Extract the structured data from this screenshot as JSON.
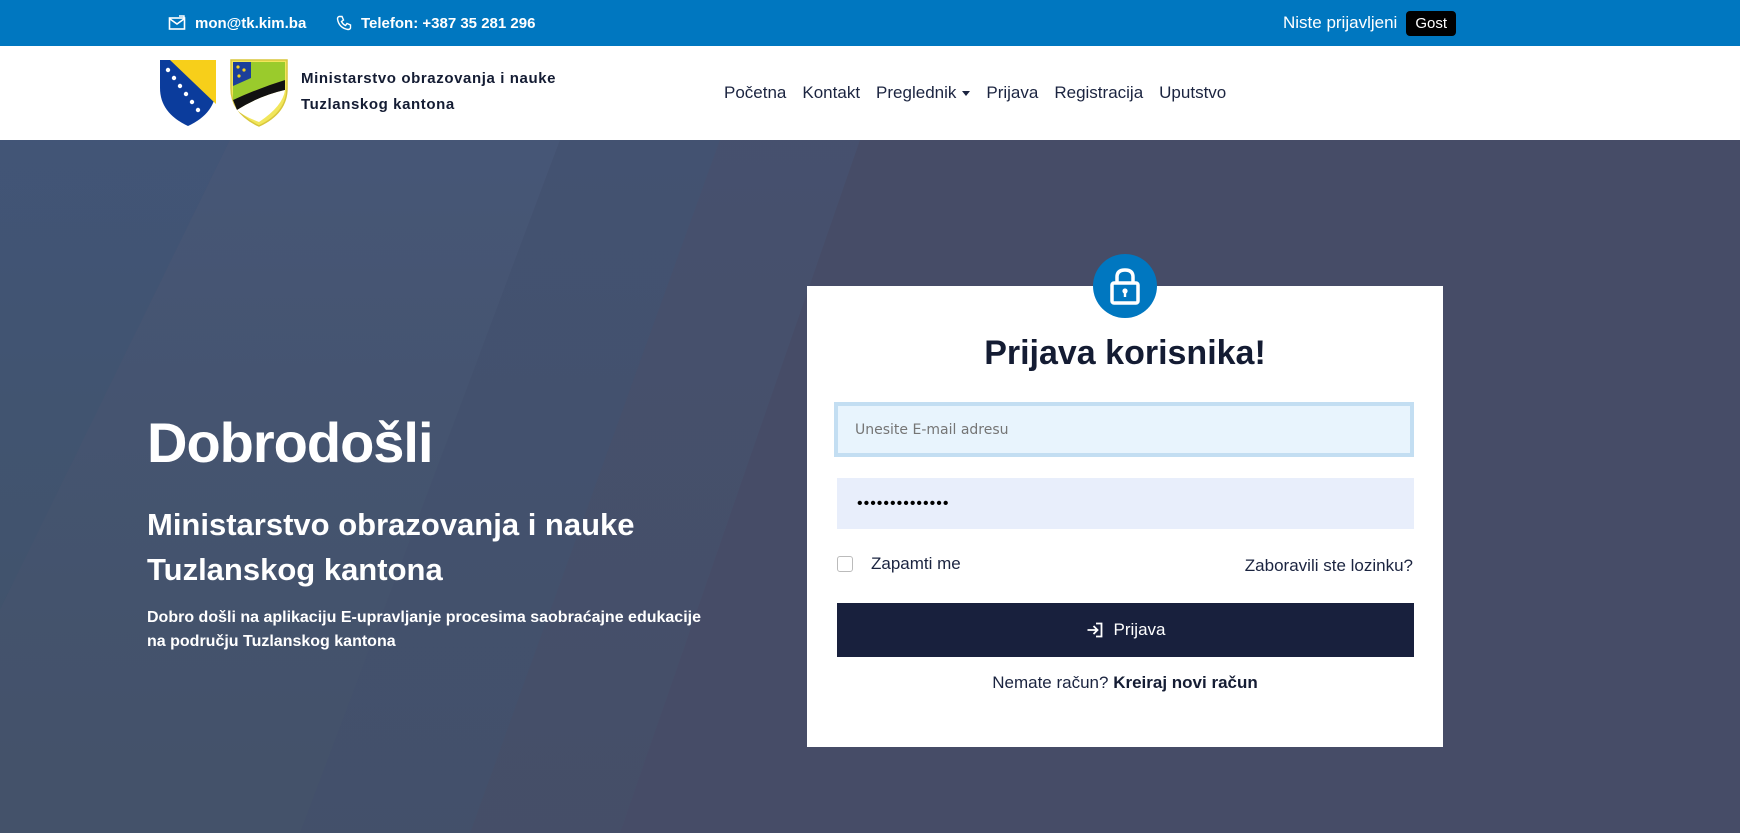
{
  "topbar": {
    "email": "mon@tk.kim.ba",
    "phone": "Telefon: +387 35 281 296",
    "login_status": "Niste prijavljeni",
    "user_badge": "Gost",
    "background_color": "#0077c0"
  },
  "header": {
    "brand_line1": "Ministarstvo obrazovanja i nauke",
    "brand_line2": "Tuzlanskog kantona",
    "nav": {
      "home": "Početna",
      "contact": "Kontakt",
      "browser": "Preglednik",
      "login": "Prijava",
      "register": "Registracija",
      "guide": "Uputstvo"
    }
  },
  "hero": {
    "welcome": "Dobrodošli",
    "subtitle_line1": "Ministarstvo obrazovanja i nauke",
    "subtitle_line2": "Tuzlanskog kantona",
    "description": "Dobro došli na aplikaciju E-upravljanje procesima saobraćajne edukacije na području Tuzlanskog kantona"
  },
  "login_card": {
    "title": "Prijava korisnika!",
    "email_placeholder": "Unesite E-mail adresu",
    "password_value": "••••••••••••••",
    "remember_label": "Zapamti me",
    "forgot_link": "Zaboravili ste lozinku?",
    "submit_label": "Prijava",
    "no_account_text": "Nemate račun?",
    "create_account_link": "Kreiraj novi račun"
  },
  "colors": {
    "primary": "#0077c0",
    "dark_navy": "#18203d",
    "hero_bg": "#464c67"
  },
  "icons": {
    "email": "envelope-icon",
    "phone": "phone-icon",
    "lock": "lock-icon",
    "login": "sign-in-icon",
    "dropdown": "caret-down-icon"
  }
}
